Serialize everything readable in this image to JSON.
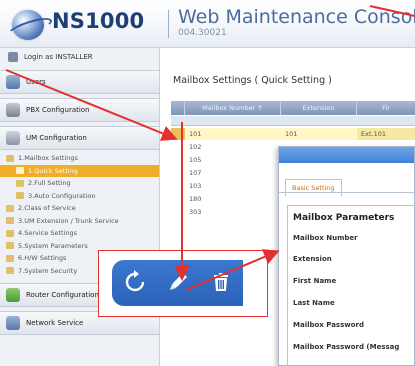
{
  "header": {
    "brand": "NS1000",
    "console_title": "Web Maintenance Console",
    "version": "004.30021"
  },
  "sidebar": {
    "login_text": "Login as INSTALLER",
    "sections": {
      "users": "Users",
      "pbx": "PBX Configuration",
      "um": "UM Configuration",
      "router": "Router Configuration",
      "network": "Network Service"
    },
    "tree": [
      {
        "label": "1.Mailbox Settings"
      },
      {
        "label": "1.Quick Setting",
        "selected": true
      },
      {
        "label": "2.Full Setting"
      },
      {
        "label": "3.Auto Configuration"
      },
      {
        "label": "2.Class of Service"
      },
      {
        "label": "3.UM Extension / Trunk Service"
      },
      {
        "label": "4.Service Settings"
      },
      {
        "label": "5.System Parameters"
      },
      {
        "label": "6.H/W Settings"
      },
      {
        "label": "7.System Security"
      }
    ]
  },
  "main": {
    "title": "Mailbox Settings ( Quick Setting )",
    "columns": [
      "Mailbox Number",
      "Extension",
      "Fir"
    ],
    "sort_indicator": "↑",
    "rows": [
      {
        "mailbox": "101",
        "extension": "101",
        "first": "Ext.101"
      },
      {
        "mailbox": "102",
        "extension": "",
        "first": ""
      },
      {
        "mailbox": "105",
        "extension": "",
        "first": ""
      },
      {
        "mailbox": "107",
        "extension": "",
        "first": ""
      },
      {
        "mailbox": "103",
        "extension": "",
        "first": ""
      },
      {
        "mailbox": "180",
        "extension": "",
        "first": ""
      },
      {
        "mailbox": "303",
        "extension": "",
        "first": ""
      }
    ]
  },
  "dialog": {
    "tab": "Basic Setting",
    "section_title": "Mailbox Parameters",
    "fields": [
      "Mailbox Number",
      "Extension",
      "First Name",
      "Last Name",
      "Mailbox Password",
      "Mailbox Password (Messag"
    ]
  },
  "callout": {
    "buttons": [
      "refresh-icon",
      "edit-pencil-icon",
      "delete-trash-icon"
    ],
    "icon_color": "#ffffff",
    "bar_color": "#2f6cc3",
    "border_color": "#e53030"
  },
  "colors": {
    "accent": "#f1ac28",
    "arrow": "#e53030",
    "header_text": "#1e3f76"
  }
}
